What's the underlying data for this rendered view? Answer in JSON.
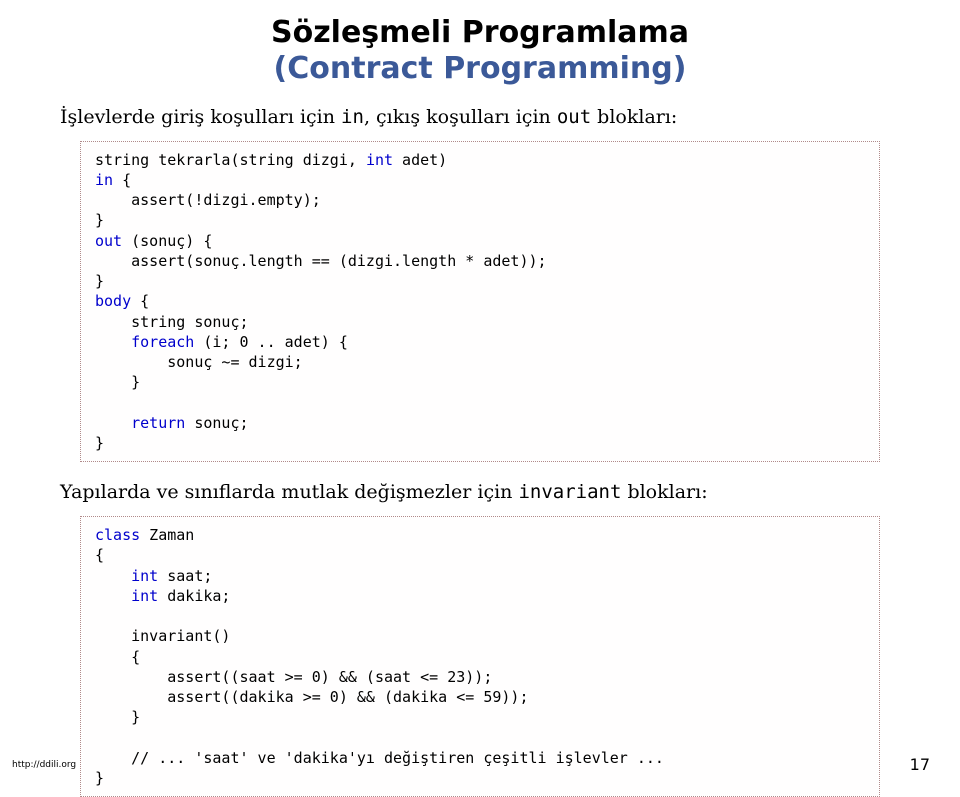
{
  "title": {
    "main": "Sözleşmeli Programlama",
    "sub": "(Contract Programming)"
  },
  "para1": {
    "t1": "İşlevlerde giriş koşulları için ",
    "kw_in": "in",
    "t2": ", çıkış koşulları için ",
    "kw_out": "out",
    "t3": " blokları:"
  },
  "code1": {
    "l1a": "string tekrarla(string dizgi, ",
    "l1b": "int",
    "l1c": " adet)",
    "l2a": "in",
    "l2b": " {",
    "l3": "    assert(!dizgi.empty);",
    "l4": "}",
    "l5a": "out",
    "l5b": " (sonuç) {",
    "l6": "    assert(sonuç.length == (dizgi.length * adet));",
    "l7": "}",
    "l8a": "body",
    "l8b": " {",
    "l9": "    string sonuç;",
    "l10a": "    ",
    "l10b": "foreach",
    "l10c": " (i; 0 .. adet) {",
    "l11": "        sonuç ~= dizgi;",
    "l12": "    }",
    "l13": "",
    "l14a": "    ",
    "l14b": "return",
    "l14c": " sonuç;",
    "l15": "}"
  },
  "para2": {
    "t1": "Yapılarda ve sınıflarda mutlak değişmezler için ",
    "kw": "invariant",
    "t2": " blokları:"
  },
  "code2": {
    "l1a": "class",
    "l1b": " Zaman",
    "l2": "{",
    "l3a": "    ",
    "l3b": "int",
    "l3c": " saat;",
    "l4a": "    ",
    "l4b": "int",
    "l4c": " dakika;",
    "l5": "",
    "l6": "    invariant()",
    "l7": "    {",
    "l8": "        assert((saat >= 0) && (saat <= 23));",
    "l9": "        assert((dakika >= 0) && (dakika <= 59));",
    "l10": "    }",
    "l11": "",
    "l12": "    // ... 'saat' ve 'dakika'yı değiştiren çeşitli işlevler ...",
    "l13": "}"
  },
  "footer": {
    "url": "http://ddili.org",
    "page": "17"
  }
}
